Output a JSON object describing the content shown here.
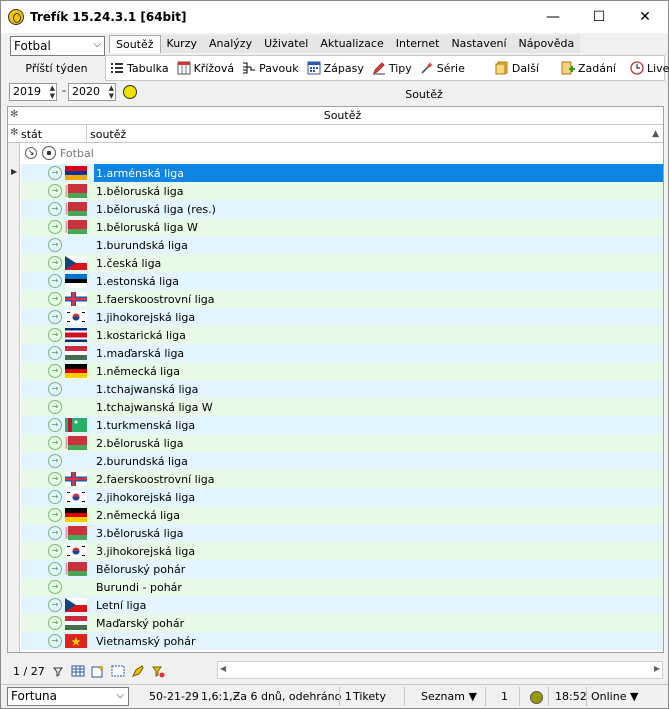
{
  "window": {
    "title": "Trefík 15.24.3.1 [64bit]",
    "minimize": "—",
    "maximize": "☐",
    "close": "✕"
  },
  "sport_select": {
    "value": "Fotbal"
  },
  "period_label": "Příští týden",
  "menu": [
    "Soutěž",
    "Kurzy",
    "Analýzy",
    "Uživatel",
    "Aktualizace",
    "Internet",
    "Nastavení",
    "Nápověda"
  ],
  "toolbar": {
    "tabulka": "Tabulka",
    "krizova": "Křížová",
    "pavouk": "Pavouk",
    "zapasy": "Zápasy",
    "tipy": "Tipy",
    "serie": "Série",
    "dalsi": "Další",
    "zadani": "Zadání",
    "live": "Live"
  },
  "filter": {
    "year_from": "2019",
    "year_to": "2020",
    "dash": "-",
    "title": "Soutěž"
  },
  "grid": {
    "band_title": "Soutěž",
    "col_state": "stát",
    "col_competition": "soutěž",
    "group_label": "Fotbal",
    "rows": [
      {
        "name": "1.arménská liga",
        "flag": "armenia"
      },
      {
        "name": "1.běloruská liga",
        "flag": "belarus"
      },
      {
        "name": "1.běloruská liga (res.)",
        "flag": "belarus"
      },
      {
        "name": "1.běloruská liga W",
        "flag": "belarus"
      },
      {
        "name": "1.burundská liga",
        "flag": "none"
      },
      {
        "name": "1.česká liga",
        "flag": "czech"
      },
      {
        "name": "1.estonská liga",
        "flag": "estonia"
      },
      {
        "name": "1.faerskoostrovní liga",
        "flag": "faroe"
      },
      {
        "name": "1.jihokorejská liga",
        "flag": "korea"
      },
      {
        "name": "1.kostarická liga",
        "flag": "costarica"
      },
      {
        "name": "1.maďarská liga",
        "flag": "hungary"
      },
      {
        "name": "1.německá liga",
        "flag": "germany"
      },
      {
        "name": "1.tchajwanská liga",
        "flag": "none"
      },
      {
        "name": "1.tchajwanská liga W",
        "flag": "none"
      },
      {
        "name": "1.turkmenská liga",
        "flag": "turkmenistan"
      },
      {
        "name": "2.běloruská liga",
        "flag": "belarus"
      },
      {
        "name": "2.burundská liga",
        "flag": "none"
      },
      {
        "name": "2.faerskoostrovní liga",
        "flag": "faroe"
      },
      {
        "name": "2.jihokorejská liga",
        "flag": "korea"
      },
      {
        "name": "2.německá liga",
        "flag": "germany"
      },
      {
        "name": "3.běloruská liga",
        "flag": "belarus"
      },
      {
        "name": "3.jihokorejská liga",
        "flag": "korea"
      },
      {
        "name": "Běloruský pohár",
        "flag": "belarus"
      },
      {
        "name": "Burundi - pohár",
        "flag": "none"
      },
      {
        "name": "Letní liga",
        "flag": "czech"
      },
      {
        "name": "Maďarský pohár",
        "flag": "hungary"
      },
      {
        "name": "Vietnamský pohár",
        "flag": "vietnam"
      }
    ]
  },
  "footer": {
    "counter": "1 / 27"
  },
  "status": {
    "bookmaker": "Fortuna",
    "code": "50-21-29",
    "info": "1,6:1,Ƶa 6 dnů, odehráno 1",
    "tikety": "Tikety",
    "seznam": "Seznam ▼",
    "count": "1",
    "time": "18:52",
    "online": "Online ▼"
  }
}
